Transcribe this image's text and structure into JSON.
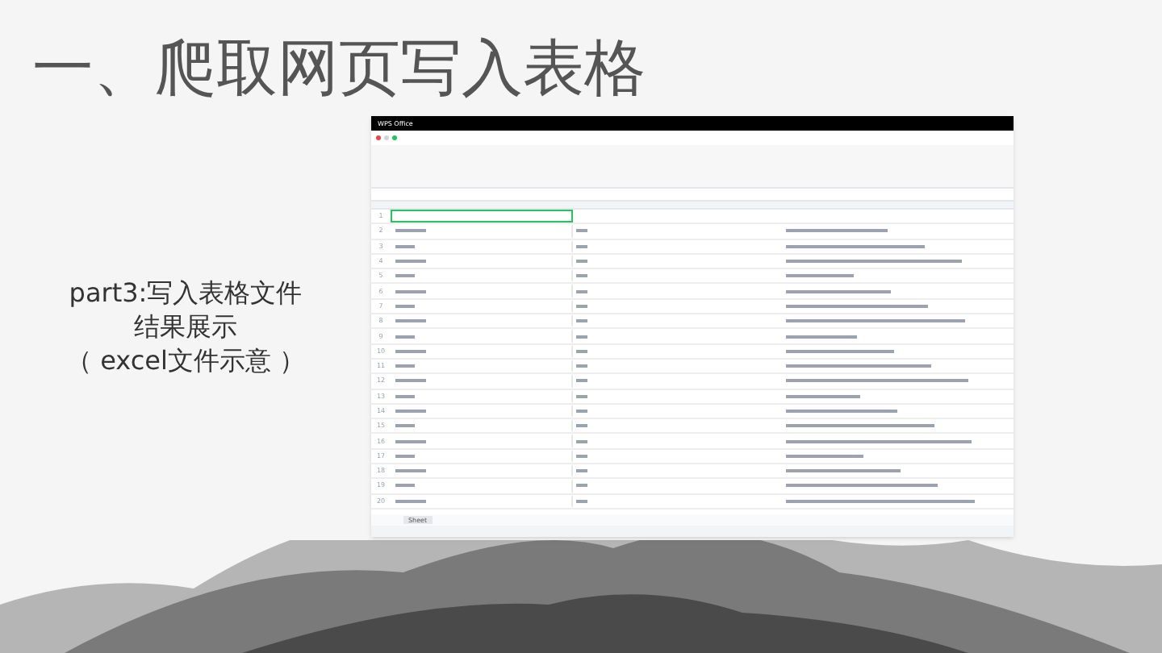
{
  "title": "一、爬取网页写入表格",
  "caption": [
    "part3:写入表格文件",
    "结果展示",
    "（ excel文件示意 ）"
  ],
  "spreadsheet": {
    "app_name": "WPS Office",
    "rows": [
      {
        "number": "1",
        "selected": true
      },
      {
        "number": "2",
        "selected": false
      },
      {
        "number": "3",
        "selected": false
      },
      {
        "number": "4",
        "selected": false
      },
      {
        "number": "5",
        "selected": false
      },
      {
        "number": "6",
        "selected": false
      },
      {
        "number": "7",
        "selected": false
      },
      {
        "number": "8",
        "selected": false
      },
      {
        "number": "9",
        "selected": false
      },
      {
        "number": "10",
        "selected": false
      },
      {
        "number": "11",
        "selected": false
      },
      {
        "number": "12",
        "selected": false
      },
      {
        "number": "13",
        "selected": false
      },
      {
        "number": "14",
        "selected": false
      },
      {
        "number": "15",
        "selected": false
      },
      {
        "number": "16",
        "selected": false
      },
      {
        "number": "17",
        "selected": false
      },
      {
        "number": "18",
        "selected": false
      },
      {
        "number": "19",
        "selected": false
      },
      {
        "number": "20",
        "selected": false
      }
    ],
    "sheet_tabs": [
      {
        "label": "Sheet",
        "selected": false
      }
    ]
  }
}
